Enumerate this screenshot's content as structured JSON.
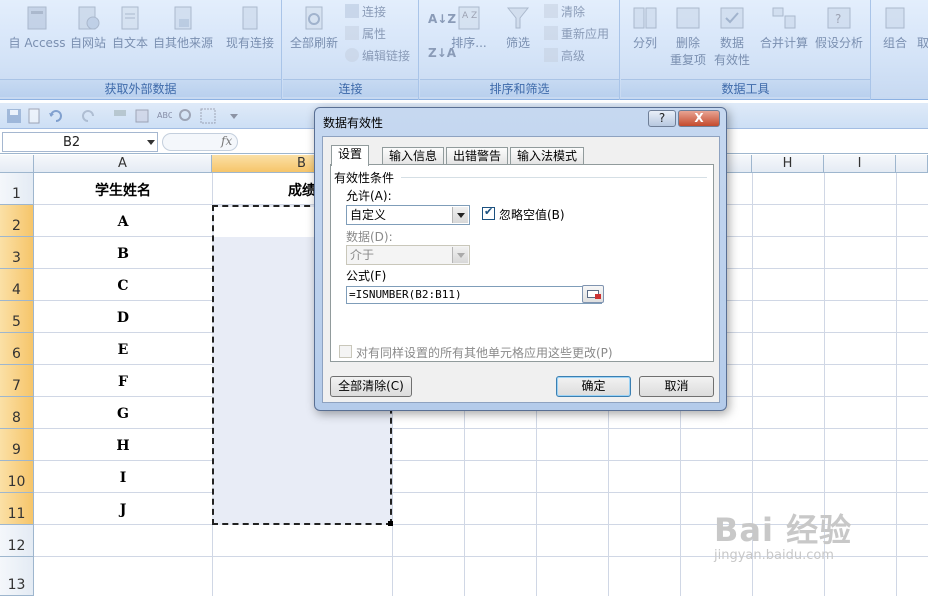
{
  "ribbon": {
    "groups": [
      {
        "label": "获取外部数据"
      },
      {
        "label": "连接"
      },
      {
        "label": "排序和筛选"
      },
      {
        "label": "数据工具"
      }
    ],
    "get_external": {
      "access": "自 Access",
      "web": "自网站",
      "text": "自文本",
      "other": "自其他来源",
      "existing": "现有连接"
    },
    "connections": {
      "refresh_all": "全部刷新",
      "connections": "连接",
      "properties": "属性",
      "edit_links": "编辑链接"
    },
    "sort_filter": {
      "sort": "排序...",
      "filter": "筛选",
      "clear": "清除",
      "reapply": "重新应用",
      "advanced": "高级"
    },
    "data_tools": {
      "text_to_columns": "分列",
      "remove_dup_1": "删除",
      "remove_dup_2": "重复项",
      "validation_1": "数据",
      "validation_2": "有效性",
      "consolidate": "合并计算",
      "what_if": "假设分析",
      "group": "组合",
      "ungroup": "取"
    }
  },
  "formula_bar": {
    "name_box": "B2",
    "fx": "fx"
  },
  "sheet": {
    "columns": [
      "A",
      "B",
      "H",
      "I"
    ],
    "rows": [
      "1",
      "2",
      "3",
      "4",
      "5",
      "6",
      "7",
      "8",
      "9",
      "10",
      "11",
      "12",
      "13"
    ],
    "header_a": "学生姓名",
    "header_b": "成绩",
    "names": [
      "A",
      "B",
      "C",
      "D",
      "E",
      "F",
      "G",
      "H",
      "I",
      "J"
    ]
  },
  "dialog": {
    "title": "数据有效性",
    "help": "?",
    "close": "X",
    "tabs": [
      "设置",
      "输入信息",
      "出错警告",
      "输入法模式"
    ],
    "section": "有效性条件",
    "allow_label": "允许(A):",
    "allow_value": "自定义",
    "ignore_blank": "忽略空值(B)",
    "data_label": "数据(D):",
    "data_value": "介于",
    "formula_label": "公式(F)",
    "formula_value": "=ISNUMBER(B2:B11)",
    "apply_all": "对有同样设置的所有其他单元格应用这些更改(P)",
    "clear_all": "全部清除(C)",
    "ok": "确定",
    "cancel": "取消"
  },
  "watermark": {
    "brand": "Bai 经验",
    "url": "jingyan.baidu.com"
  }
}
